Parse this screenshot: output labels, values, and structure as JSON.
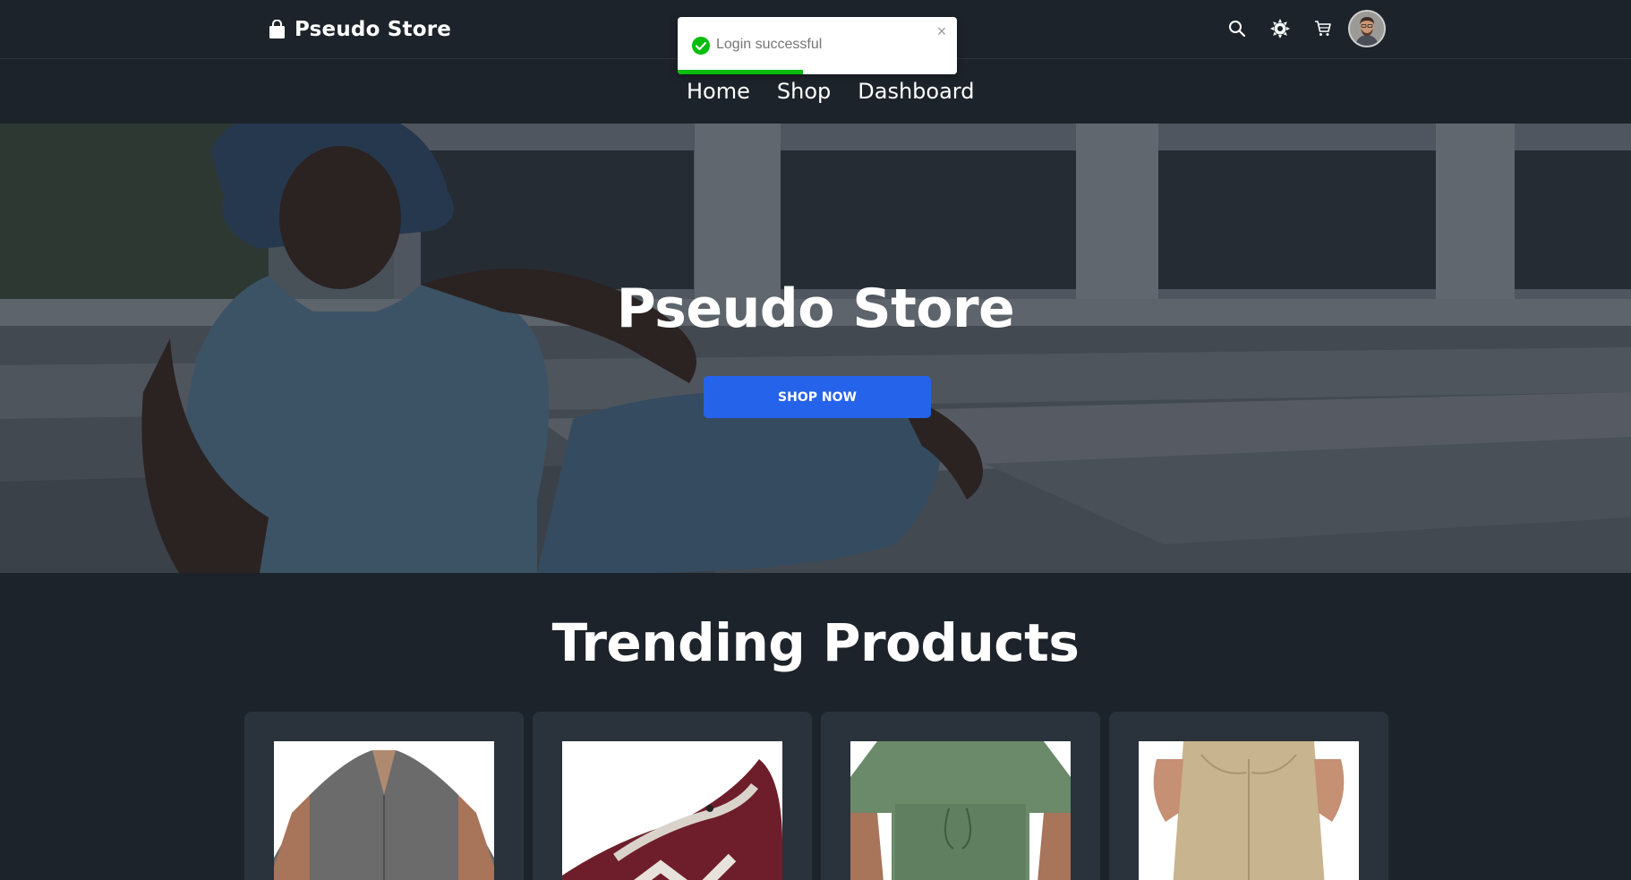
{
  "brand": {
    "name": "Pseudo Store",
    "icon": "shopping-bag-icon"
  },
  "nav": {
    "actions": [
      {
        "name": "search",
        "icon": "search-icon"
      },
      {
        "name": "theme",
        "icon": "sun-icon"
      },
      {
        "name": "cart",
        "icon": "cart-icon"
      },
      {
        "name": "profile",
        "icon": "avatar"
      }
    ],
    "menu": [
      {
        "label": "Home"
      },
      {
        "label": "Shop"
      },
      {
        "label": "Dashboard"
      }
    ]
  },
  "toast": {
    "message": "Login successful",
    "status": "success",
    "icon": "check-circle-icon",
    "close_icon": "close-icon",
    "progress_fraction": 0.45,
    "color": "#07bc0c"
  },
  "hero": {
    "title": "Pseudo Store",
    "cta_label": "SHOP NOW",
    "cta_color": "#2563eb"
  },
  "trending": {
    "title": "Trending Products",
    "products": [
      {
        "image": "grey-shirt"
      },
      {
        "image": "maroon-sneaker"
      },
      {
        "image": "green-set"
      },
      {
        "image": "khaki-pants"
      }
    ]
  },
  "colors": {
    "background": "#1d232a",
    "card": "#2a323c",
    "accent": "#2563eb"
  }
}
